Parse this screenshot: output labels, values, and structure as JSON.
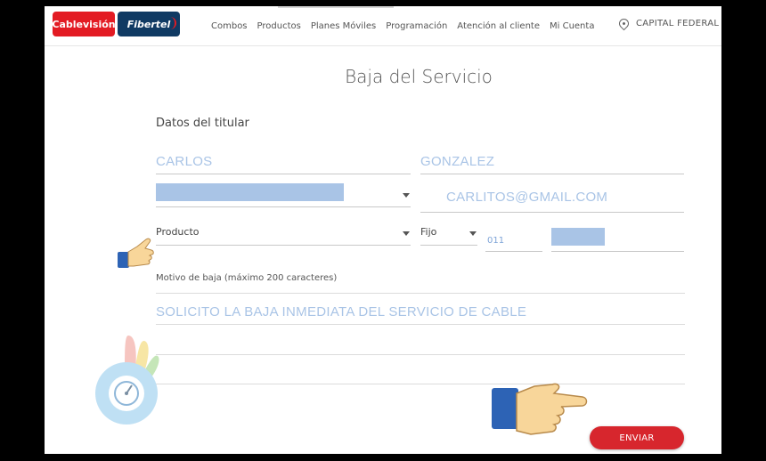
{
  "header": {
    "logo_cablevision": "Cablevisión",
    "logo_fibertel": "Fibertel",
    "nav": [
      "Combos",
      "Productos",
      "Planes Móviles",
      "Programación",
      "Atención al cliente",
      "Mi Cuenta"
    ],
    "location": "CAPITAL FEDERAL"
  },
  "main": {
    "title": "Baja del Servicio",
    "section_label": "Datos del titular",
    "first_name": "CARLOS",
    "last_name": "GONZALEZ",
    "email": "CARLITOS@GMAIL.COM",
    "product_label": "Producto",
    "phone_type": "Fijo",
    "area_code": "011",
    "motivo_label": "Motivo de baja (máximo 200 caracteres)",
    "motivo_text": "SOLICITO LA BAJA INMEDIATA DEL SERVICIO DE CABLE",
    "submit_label": "ENVIAR"
  },
  "colors": {
    "brand_red": "#e31b23",
    "brand_navy": "#103a63",
    "filled_value": "#a9c4e6",
    "submit": "#d7262d"
  }
}
